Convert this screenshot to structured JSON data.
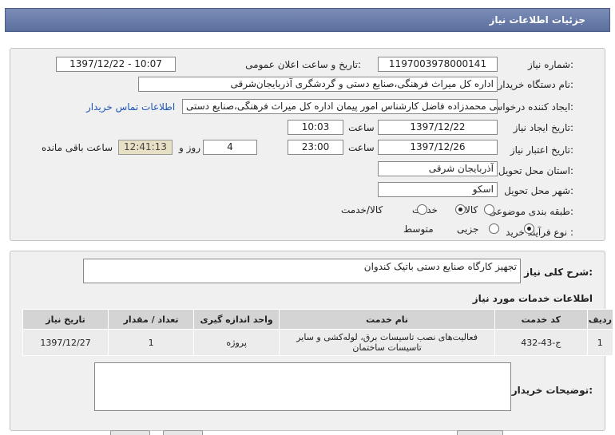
{
  "header": {
    "title": "جزئیات اطلاعات نیاز"
  },
  "fields": {
    "need_number_label": "شماره نیاز:",
    "need_number": "1197003978000141",
    "announce_label": "تاریخ و ساعت اعلان عمومی:",
    "announce_value": "1397/12/22 - 10:07",
    "buyer_org_label": "نام دستگاه خریدار:",
    "buyer_org": "اداره کل میراث فرهنگی،صنایع دستی و گردشگری آذربایجان‌شرقی",
    "requester_label": "ایجاد کننده درخواست:",
    "requester": "علی محمدزاده فاضل کارشناس امور پیمان اداره کل میراث فرهنگی،صنایع دستی",
    "contact_link": "اطلاعات تماس خریدار",
    "created_label": "تاریخ ایجاد نیاز:",
    "created_date": "1397/12/22",
    "time_label": "ساعت",
    "created_time": "10:03",
    "valid_label": "تاریخ اعتبار نیاز:",
    "valid_date": "1397/12/26",
    "valid_time": "23:00",
    "days_value": "4",
    "days_label": "روز و",
    "remaining_time": "12:41:13",
    "remaining_label": "ساعت باقی مانده",
    "province_label": "استان محل تحویل:",
    "province": "آذربایجان شرقی",
    "city_label": "شهر محل تحویل:",
    "city": "اسکو",
    "category_label": "طبقه بندی موضوعی:",
    "category_options": [
      "کالا",
      "خدمت",
      "کالا/خدمت"
    ],
    "category_selected": "خدمت",
    "process_label": "نوع فرآیند خرید :",
    "process_options": [
      "جزیی",
      "متوسط"
    ],
    "process_selected": "جزیی"
  },
  "summary": {
    "label": "شرح کلی نیاز:",
    "value": "تجهیز کارگاه صنایع دستی باتیک کندوان"
  },
  "services": {
    "title": "اطلاعات خدمات مورد نیاز",
    "columns": [
      "ردیف",
      "کد خدمت",
      "نام خدمت",
      "واحد اندازه گیری",
      "تعداد / مقدار",
      "تاریخ نیاز"
    ],
    "rows": [
      [
        "1",
        "ج-43-432",
        "فعالیت‌های نصب تاسیسات برق، لوله‌کشی و سایر تاسیسات ساختمان",
        "پروژه",
        "1",
        "1397/12/27"
      ]
    ]
  },
  "buyer_notes": {
    "label": "توضیحات خریدار:",
    "value": ""
  }
}
